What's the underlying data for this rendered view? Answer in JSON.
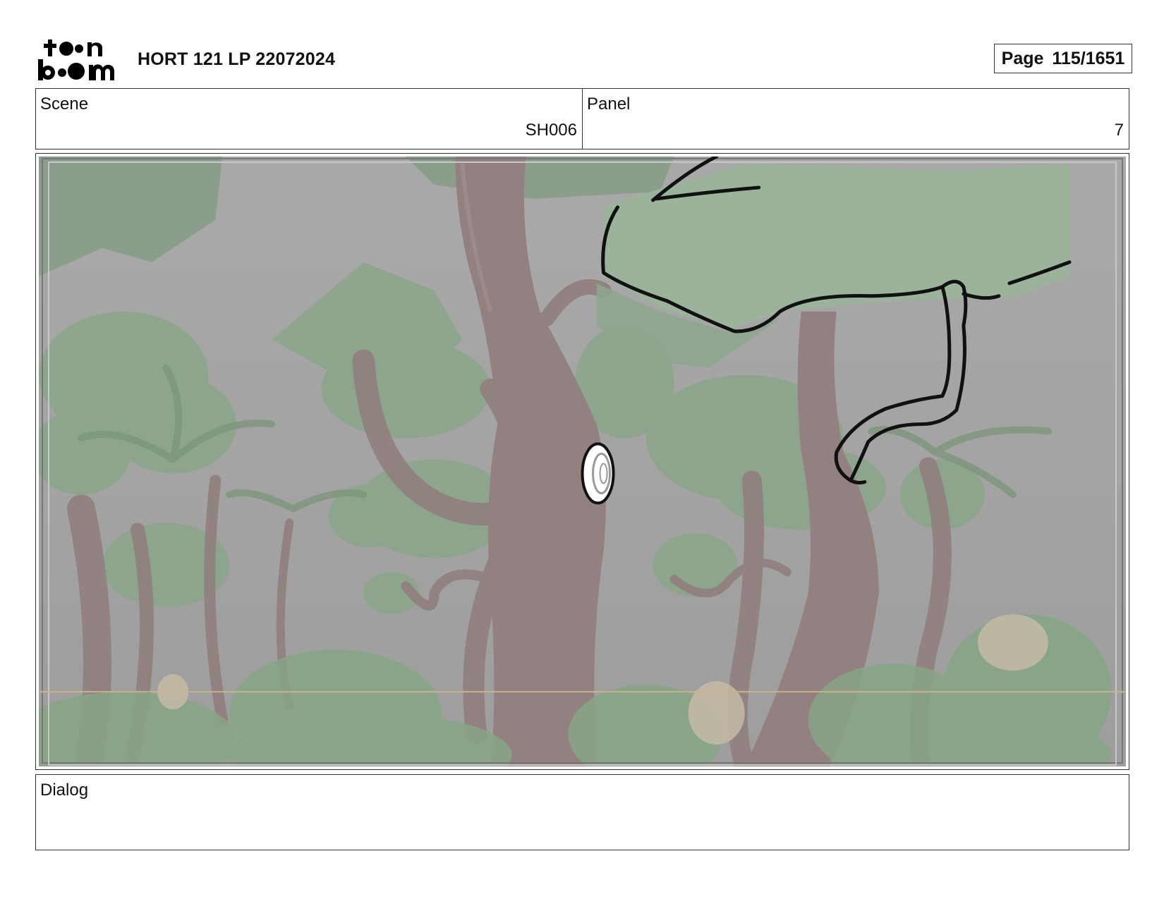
{
  "header": {
    "logo_text_top": "toon",
    "logo_text_bottom": "boom",
    "title": "HORT 121 LP 22072024",
    "page_label": "Page",
    "page_number": "115/1651"
  },
  "info": {
    "scene_label": "Scene",
    "scene_value": "SH006",
    "panel_label": "Panel",
    "panel_value": "7"
  },
  "panel_image": {
    "icon": "jungle-storyboard-frame",
    "colors": {
      "sky": "#9e9e9e",
      "foliage": "#7fa07f",
      "trunk": "#8a7473",
      "ink": "#111111"
    }
  },
  "dialog": {
    "label": "Dialog",
    "text": ""
  }
}
